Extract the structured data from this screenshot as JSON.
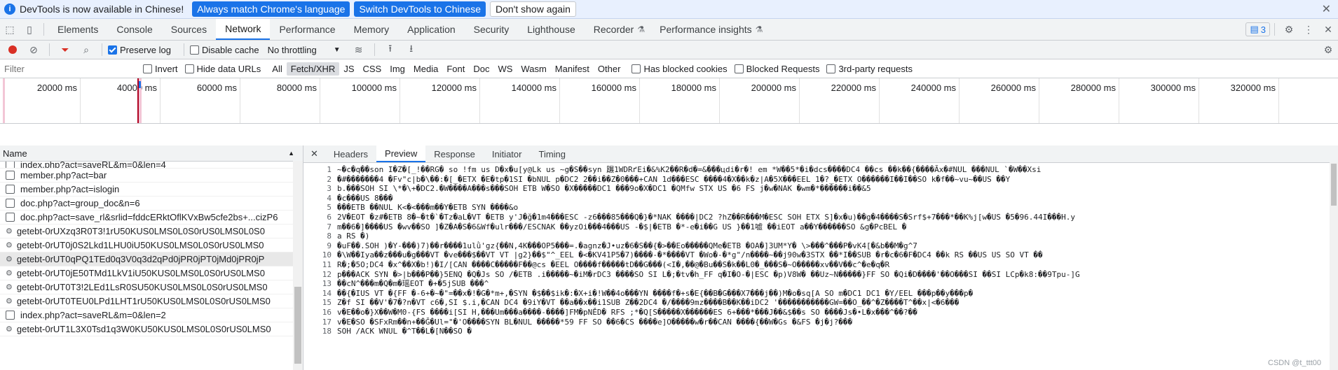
{
  "infobar": {
    "message": "DevTools is now available in Chinese!",
    "btn_match": "Always match Chrome's language",
    "btn_switch": "Switch DevTools to Chinese",
    "btn_dismiss": "Don't show again"
  },
  "tabs": [
    "Elements",
    "Console",
    "Sources",
    "Network",
    "Performance",
    "Memory",
    "Application",
    "Security",
    "Lighthouse",
    "Recorder",
    "Performance insights"
  ],
  "active_tab": "Network",
  "issues_count": "3",
  "toolbar": {
    "preserve_log": "Preserve log",
    "disable_cache": "Disable cache",
    "throttling": "No throttling"
  },
  "filter": {
    "placeholder": "Filter",
    "invert": "Invert",
    "hide_data_urls": "Hide data URLs",
    "types": [
      "All",
      "Fetch/XHR",
      "JS",
      "CSS",
      "Img",
      "Media",
      "Font",
      "Doc",
      "WS",
      "Wasm",
      "Manifest",
      "Other"
    ],
    "active_type": "Fetch/XHR",
    "blocked_cookies": "Has blocked cookies",
    "blocked_requests": "Blocked Requests",
    "third_party": "3rd-party requests"
  },
  "timeline": {
    "ticks": [
      "20000 ms",
      "40000 ms",
      "60000 ms",
      "80000 ms",
      "100000 ms",
      "120000 ms",
      "140000 ms",
      "160000 ms",
      "180000 ms",
      "200000 ms",
      "220000 ms",
      "240000 ms",
      "260000 ms",
      "280000 ms",
      "300000 ms",
      "320000 ms",
      "340"
    ]
  },
  "requests": {
    "header": "Name",
    "items": [
      "index.php?act=saveRL&m=0&len=4",
      "member.php?act=bar",
      "member.php?act=islogin",
      "doc.php?act=group_doc&n=6",
      "doc.php?act=save_rl&srlid=fddcERktOflKVxBw5cfe2bs+...cizP6",
      "getebt-0rUXzq3R0T3!1rU50KUS0LMS0L0S0rUS0LMS0L0S0",
      "getebt-0rUT0j0S2Lkd1LHU0iU50KUS0LMS0L0S0rUS0LMS0",
      "getebt-0rUT0qPQ1TEd0q3V0q3d2qPd0jPR0jPT0jMd0jPR0jP",
      "getebt-0rUT0jE50TMd1LkV1iU50KUS0LMS0L0S0rUS0LMS0",
      "getebt-0rUT0T3!2LEd1LsR0SU50KUS0LMS0L0S0rUS0LMS0",
      "getebt-0rUT0TEU0LPd1LHT1rU50KUS0LMS0L0S0rUS0LMS0",
      "index.php?act=saveRL&m=0&len=2",
      "getebt-0rUT1L3X0Tsd1q3W0KU50KUS0LMS0L0S0rUS0LMS0"
    ],
    "selected_index": 7
  },
  "detail": {
    "tabs": [
      "Headers",
      "Preview",
      "Response",
      "Initiator",
      "Timing"
    ],
    "active_tab": "Preview",
    "line_numbers": [
      "1",
      "2",
      "3",
      "4",
      "5",
      "6",
      "7",
      "8",
      "9",
      "10",
      "11",
      "12",
      "13",
      "14",
      "15",
      "16",
      "17",
      "18"
    ],
    "lines": [
      "~�c�q��son I�Z�[_!��RG� so !fm us D�x�u[y@Lk us ~g�S��syn 蹍1WDRґEi�&%K2��R�d�=&���цdi�r�! em *W��5*�i�dcs����DC4 ��cs ��k��{����Ãx�#NUL ���NUL `�W��Xsi",
      "�#�������4 �Fv\"c|b�\\��:�[_�ETX �E�tp�1SI �bNUL p�DC2 2��i��Z�0���+CAN 1d���ESC ����4�X��k�z|A�5X���EEL 1�?_�ETX O������I��I��SO k�f��~vu~��US ��Y",
      "b.���SOH SI \\*�\\+�DC2.�W����A���s���SOH ETB W�SO �X�����DC1 ���9o�X�DC1 �QMfw STX US �6 FS j�w�NAK �wm�*������i��&5",
      "�c���US 8���",
      "���ETB ��NUL K<�<���m��Y�ETB SYN ����&o",
      "2V�EOT �z#�ETB 8�~�t�`�Tz�aL�VT �ETB y'J�ğ�1m4���ESC -z6���85���Q�}�*NAK ����|DC2 ?hZ��R���M�ESC SOH ETX S]�x�u)��g�4����S�Srf$+7���*��K%j[w�US �5�96.44I���H.y",
      "m��6�]����US �wv��SO ]�Z�A�S�6&Wf�ulr���/ESCNAK ��yzOi���4���US -�$|�ETB �*-e�i��G US }��1嘘 ��iEOT a��Y������SO &g�PcBEL �",
      "a RS �)",
      "�uF��.SOH )�Y-���)7)��r����1ulǜ'gz{��N,4K���OP5���=.�agnz�J•uz�6�S��{�>��Eo�����QMe�ETB �OA�]3UM*Y�    \\>���^���P�vK4[�&b��M�g^7",
      "�\\W��Iya��z���u�g���VT �ve���$��VT VT |g2}��$\"^_EEL �<�KV41P5�7)����-�*����VT �Wo�-�*g\"/n����~��j90w�3STX ��*I��SUB �r�c�6�F�DC4    ��k RS ��US US SO VT ��",
      "R�;�5O;DC4 �x^��X�b!)�I/[CAN ����C�����F��@cs �EEL O����f�����tD��G���(<I�,��@�Bu��S�k��L0�_���S�~O�����xv��V��c^�e�q�R",
      "p���ACK SYN �>|b���P��}5ENQ �Q�Js SO /�ETB .i�����~�iM�rDC3 ����SO SI L�;�tv�h_FF q�I�O-�|ESC �p)V8W� ��Uz~N�����}FF SO �Qi�D����'��O���SI ��SI LCp�k8:��9Tpu-]G",
      "��cN^���m�Q�m�瑶EOT �+�5jSUB ���^",
      "��{�IUS VT �{FF �-6+�~�\"=��x�!�G�*m+,�SYN �$��$ik�:�X+i�!W��4o���YN ����f�+s�E{��B�G���X7���j��)M�o�sq[A SO m�DC1 DC1 �Y/EEL ���p��y���p�",
      "Z�f SI ��V'�7�?n�VT c6�,SI $.i,�CAN DC4 �9iY�VT ��a��x��i1SUB Z��2DC4 �/����9mz����B��K��iDC2 '�����������GW=��O_��^�Z����T^��x|<�6���",
      "v�E��o�}X��W�M0-{FS ����i[SI H,���Um���a����-����]FM�pNĚD� RFS ;*�Q[S�����X������ES 6+���*���J��&$��s SO ����Js�•L�x���^��?��",
      "v�E�SO �SFxRm��n+��Ğ�Ul=\"�'O����SYN BL�NUL �����*59 FF SO ��6�CS ����e]O�����w�r��CAN ����{��W�Gs �&FS �j�j?���",
      "SOH /ACK WNUL �^T��L�[N��SO �"
    ],
    "watermark": "CSDN @t_ttt00"
  }
}
